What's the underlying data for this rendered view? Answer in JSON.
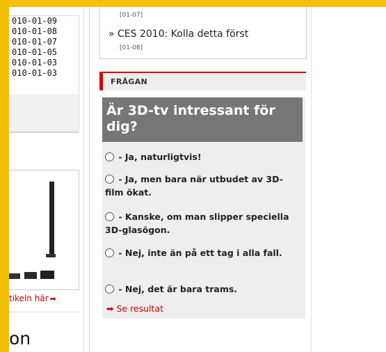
{
  "left_column": {
    "dates": [
      "010-01-09",
      "010-01-08",
      "010-01-07",
      "010-01-05",
      "010-01-03",
      "010-01-03"
    ],
    "article_link": "tikeln här",
    "big_word": "on"
  },
  "news": {
    "date_top": "[01-07]",
    "item_title": "CES 2010: Kolla detta först",
    "item_bullet": "»",
    "item_date": "[01-08]"
  },
  "poll": {
    "header": "FRÅGAN",
    "question": "Är 3D-tv intressant för dig?",
    "options": [
      "- Ja, naturligtvis!",
      "- Ja, men bara när utbudet av 3D-film ökat.",
      "- Kanske, om man slipper speciella 3D-glasögon.",
      "- Nej, inte än på ett tag i alla fall.",
      "- Nej, det är bara trams."
    ],
    "results_link": "Se resultat"
  },
  "colors": {
    "frame": "#f5c000",
    "accent_red": "#dd0000",
    "question_bg": "#767676"
  }
}
